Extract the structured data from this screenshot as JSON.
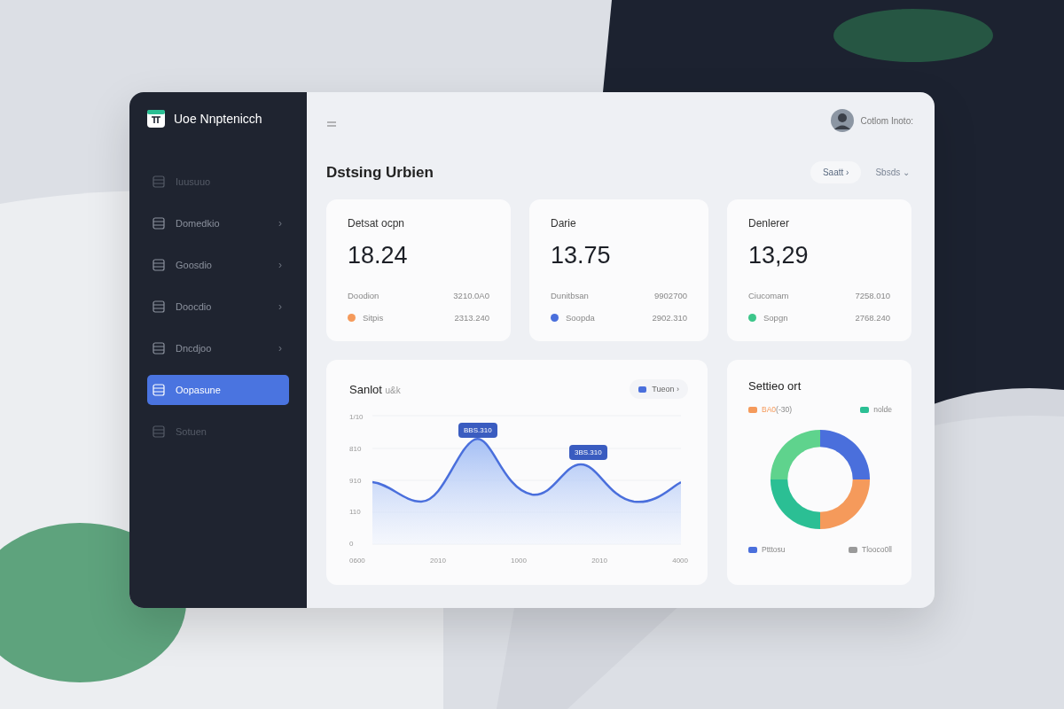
{
  "brand": {
    "name": "Uoe Nnptenicch"
  },
  "sidebar": {
    "items": [
      {
        "label": "Iuusuuo",
        "selected": false,
        "dimmed": true
      },
      {
        "label": "Domedkio",
        "selected": false,
        "dimmed": false,
        "chevron": "›"
      },
      {
        "label": "Goosdio",
        "selected": false,
        "dimmed": false,
        "chevron": "›"
      },
      {
        "label": "Doocdio",
        "selected": false,
        "dimmed": false,
        "chevron": "›"
      },
      {
        "label": "Dncdjoo",
        "selected": false,
        "dimmed": false,
        "chevron": "›"
      },
      {
        "label": "Oopasune",
        "selected": true,
        "dimmed": false
      },
      {
        "label": "Sotuen",
        "selected": false,
        "dimmed": true
      }
    ]
  },
  "header": {
    "user_name": "Cotlom Inoto:"
  },
  "page": {
    "title": "Dstsing Urbien",
    "buttons": [
      {
        "label": "Saatt",
        "kind": "pill",
        "glyph": "›"
      },
      {
        "label": "Sbsds",
        "kind": "dropdown",
        "glyph": "⌄"
      }
    ]
  },
  "stat_cards": [
    {
      "title": "Detsat ocpn",
      "value": "18.24",
      "rows": [
        {
          "label": "Doodion",
          "value": "3210.0A0"
        },
        {
          "label": "Sitpis",
          "value": "2313.240",
          "color": "#f59a5b"
        }
      ]
    },
    {
      "title": "Darie",
      "value": "13.75",
      "rows": [
        {
          "label": "Dunitbsan",
          "value": "9902700"
        },
        {
          "label": "Soopda",
          "value": "2902.310",
          "color": "#4a6fdc"
        }
      ]
    },
    {
      "title": "Denlerer",
      "value": "13,29",
      "rows": [
        {
          "label": "Ciucomam",
          "value": "7258.010"
        },
        {
          "label": "Sopgn",
          "value": "2768.240",
          "color": "#3cc68a"
        }
      ]
    }
  ],
  "line_card": {
    "title": "Sanlot",
    "subtitle": "u&k",
    "button": {
      "label": "Tueon",
      "glyph": "›"
    },
    "y_labels": [
      "1/10",
      "810",
      "910",
      "110",
      "0"
    ],
    "x_labels": [
      "0600",
      "2010",
      "1000",
      "2010",
      "4000"
    ],
    "tooltips": [
      "BBS.310",
      "3BS.310"
    ]
  },
  "donut_card": {
    "title": "Settieo ort",
    "legend": [
      {
        "label": "BA0",
        "note": "(-30)",
        "color": "#f59a5b"
      },
      {
        "label": "nolde",
        "color": "#2bbf94"
      },
      {
        "label": "Ptttosu",
        "color": "#4a6fdc"
      },
      {
        "label": "Tlooco0ll",
        "color": "#9a9a9a"
      }
    ],
    "segments": [
      {
        "color": "#4a6fdc"
      },
      {
        "color": "#f59a5b"
      },
      {
        "color": "#2bbf94"
      },
      {
        "color": "#5fd38d"
      }
    ]
  }
}
